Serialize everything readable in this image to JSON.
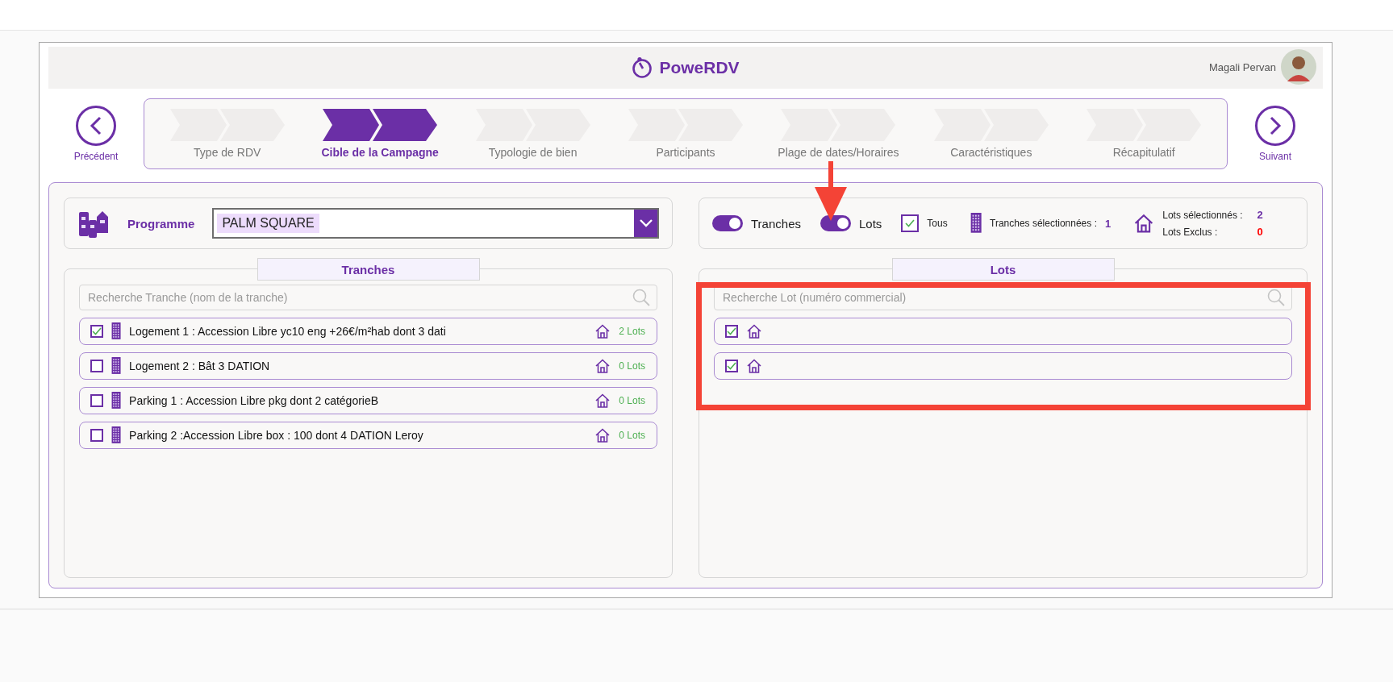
{
  "app": {
    "title": "PoweRDV",
    "user": "Magali Pervan"
  },
  "nav": {
    "previous": "Précédent",
    "next": "Suivant"
  },
  "steps": [
    {
      "label": "Type de RDV",
      "selected": false
    },
    {
      "label": "Cible de la Campagne",
      "selected": true
    },
    {
      "label": "Typologie de bien",
      "selected": false
    },
    {
      "label": "Participants",
      "selected": false
    },
    {
      "label": "Plage de dates/Horaires",
      "selected": false
    },
    {
      "label": "Caractéristiques",
      "selected": false
    },
    {
      "label": "Récapitulatif",
      "selected": false
    }
  ],
  "programme": {
    "label": "Programme",
    "value": "PALM SQUARE"
  },
  "filters": {
    "toggles": [
      {
        "label": "Tranches",
        "on": true
      },
      {
        "label": "Lots",
        "on": true
      }
    ],
    "all": {
      "label": "Tous",
      "checked": true
    },
    "tranches_selected": {
      "label": "Tranches sélectionnées :",
      "value": "1"
    },
    "lots_selected": {
      "label": "Lots sélectionnés :",
      "value": "2"
    },
    "lots_excluded": {
      "label": "Lots Exclus :",
      "value": "0"
    }
  },
  "tranches": {
    "title": "Tranches",
    "placeholder": "Recherche Tranche (nom de la tranche)",
    "rows": [
      {
        "name": "Logement 1 : Accession Libre yc10 eng +26€/m²hab dont 3 dati",
        "checked": true,
        "lots": "2 Lots"
      },
      {
        "name": "Logement 2 : Bât 3 DATION",
        "checked": false,
        "lots": "0 Lots"
      },
      {
        "name": "Parking 1 : Accession Libre pkg dont 2 catégorieB",
        "checked": false,
        "lots": "0 Lots"
      },
      {
        "name": "Parking 2 :Accession Libre box : 100 dont 4 DATION Leroy",
        "checked": false,
        "lots": "0 Lots"
      }
    ]
  },
  "lots": {
    "title": "Lots",
    "placeholder": "Recherche Lot (numéro commercial)",
    "rows": [
      {
        "checked": true
      },
      {
        "checked": true
      }
    ]
  },
  "annotations": {
    "arrow": {
      "shown": true
    },
    "frame": {
      "shown": true
    }
  }
}
